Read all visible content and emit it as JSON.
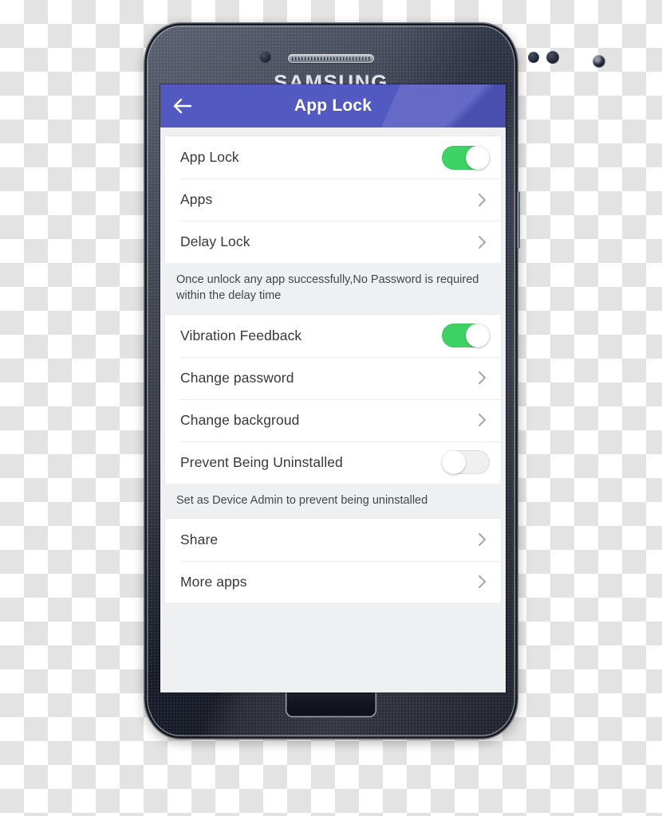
{
  "device": {
    "brand": "SAMSUNG"
  },
  "appbar": {
    "title": "App Lock",
    "back_icon": "arrow-left-icon",
    "accent_color": "#5259c0"
  },
  "colors": {
    "toggle_on": "#3ed264",
    "toggle_off_track": "#f0f0f0",
    "screen_background": "#eef0f2",
    "card_background": "#ffffff",
    "row_text": "#35383d",
    "description_text": "#42464c",
    "chevron": "#a5a7ac"
  },
  "sections": [
    {
      "rows": [
        {
          "label": "App Lock",
          "control": "toggle",
          "state": "on"
        },
        {
          "label": "Apps",
          "control": "chevron"
        },
        {
          "label": "Delay Lock",
          "control": "chevron"
        }
      ],
      "description": "Once unlock any app successfully,No Password is required within the delay time"
    },
    {
      "rows": [
        {
          "label": "Vibration Feedback",
          "control": "toggle",
          "state": "on"
        },
        {
          "label": "Change password",
          "control": "chevron"
        },
        {
          "label": "Change backgroud",
          "control": "chevron"
        },
        {
          "label": "Prevent Being Uninstalled",
          "control": "toggle",
          "state": "off"
        }
      ],
      "description": "Set as Device Admin to prevent being uninstalled"
    },
    {
      "rows": [
        {
          "label": "Share",
          "control": "chevron"
        },
        {
          "label": "More apps",
          "control": "chevron"
        }
      ],
      "description": null
    }
  ]
}
